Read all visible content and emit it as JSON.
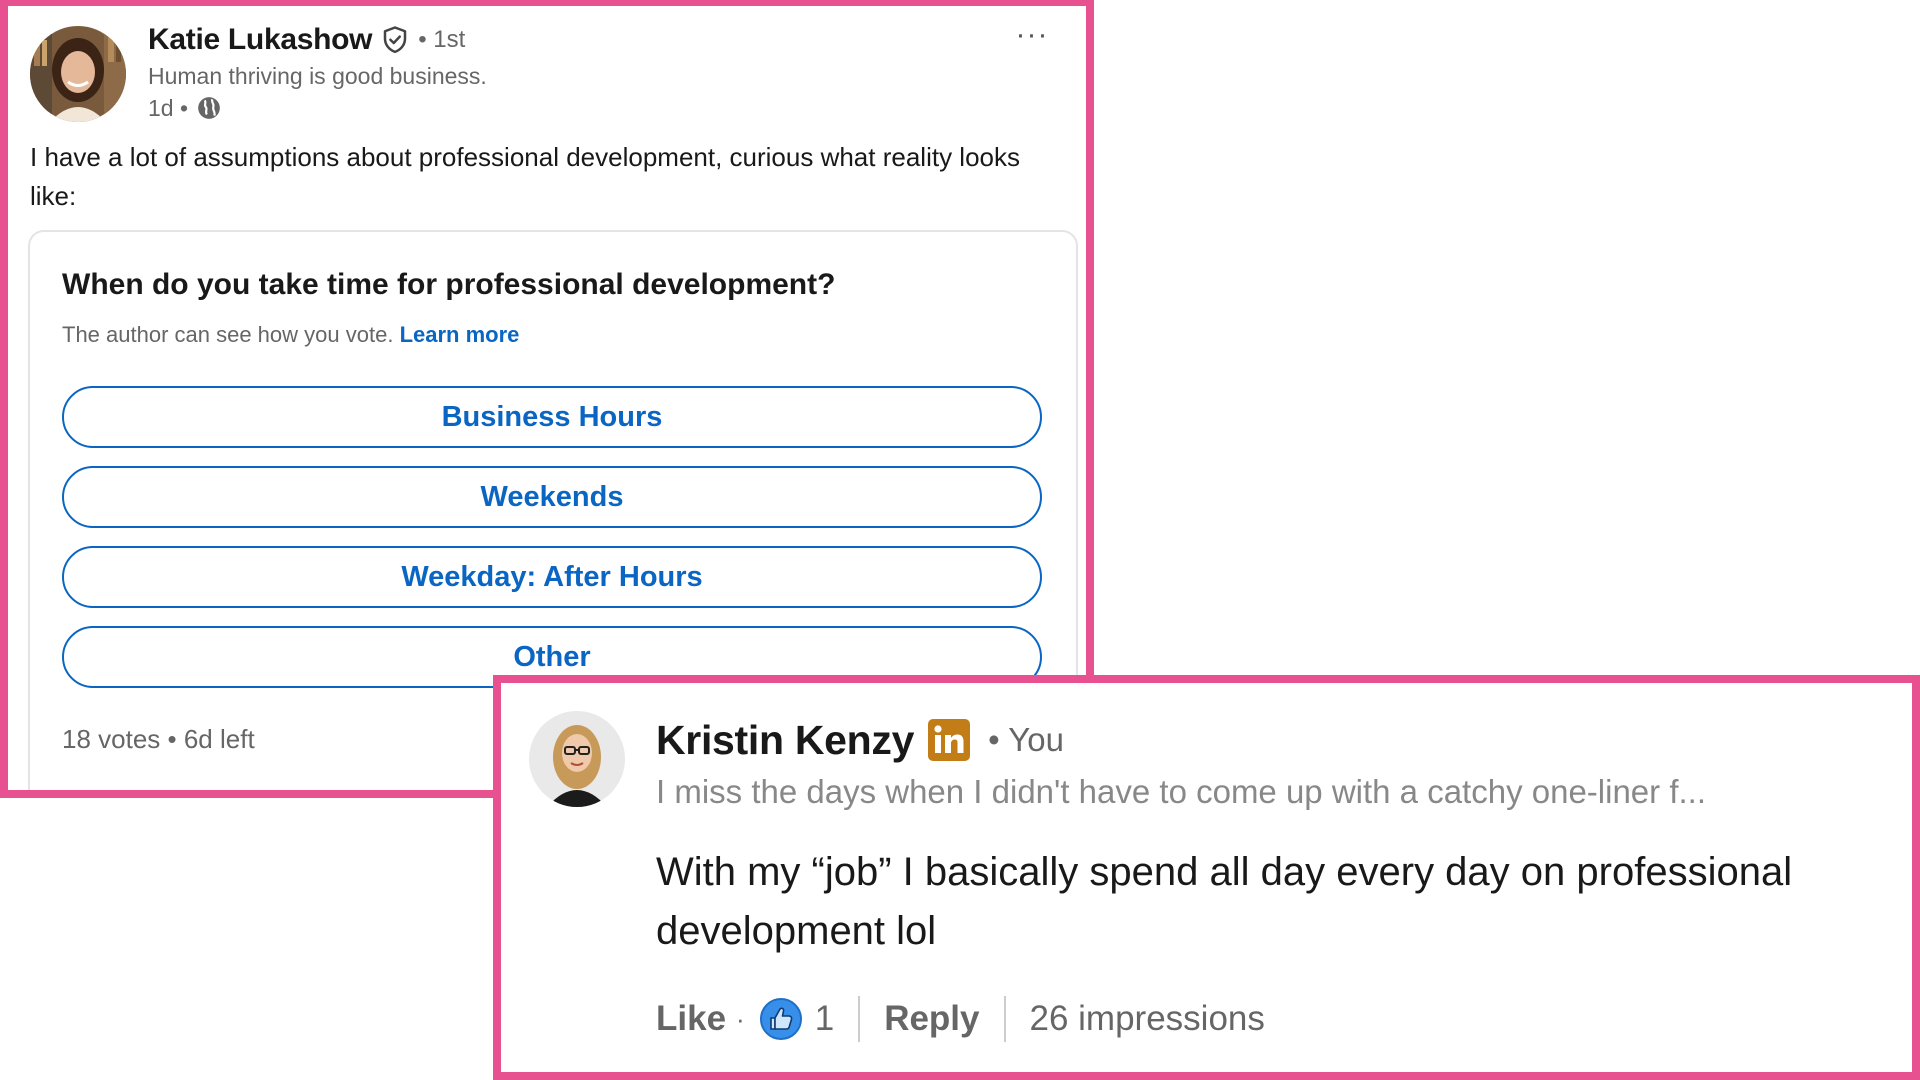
{
  "post": {
    "author": "Katie Lukashow",
    "degree": "• 1st",
    "headline": "Human thriving is good business.",
    "time": "1d •",
    "more": "···",
    "body": "I have a lot of assumptions about professional development, curious what reality looks like:",
    "icons": {
      "verified": "verified-shield-icon",
      "visibility": "globe-icon",
      "more": "more-horizontal-icon"
    }
  },
  "poll": {
    "question": "When do you take time for professional development?",
    "note": "The author can see how you vote.",
    "learn_more": "Learn more",
    "options": [
      {
        "label": "Business Hours"
      },
      {
        "label": "Weekends"
      },
      {
        "label": "Weekday: After Hours"
      },
      {
        "label": "Other"
      }
    ],
    "footer": "18 votes • 6d left"
  },
  "comment": {
    "author": "Kristin Kenzy",
    "relation": "• You",
    "headline": "I miss the days when I didn't have to come up with a catchy one-liner f...",
    "body": "With my “job” I basically spend all day every day on professional development lol",
    "like_label": "Like",
    "dot": "·",
    "reaction_count": "1",
    "reply_label": "Reply",
    "impressions": "26 impressions",
    "icons": {
      "badge": "linkedin-premium-icon",
      "reaction": "like-reaction-icon"
    }
  },
  "colors": {
    "frame": "#e8518f",
    "link": "#0a66c2",
    "text": "#191919",
    "muted": "#666666",
    "premium": "#c37d16"
  }
}
